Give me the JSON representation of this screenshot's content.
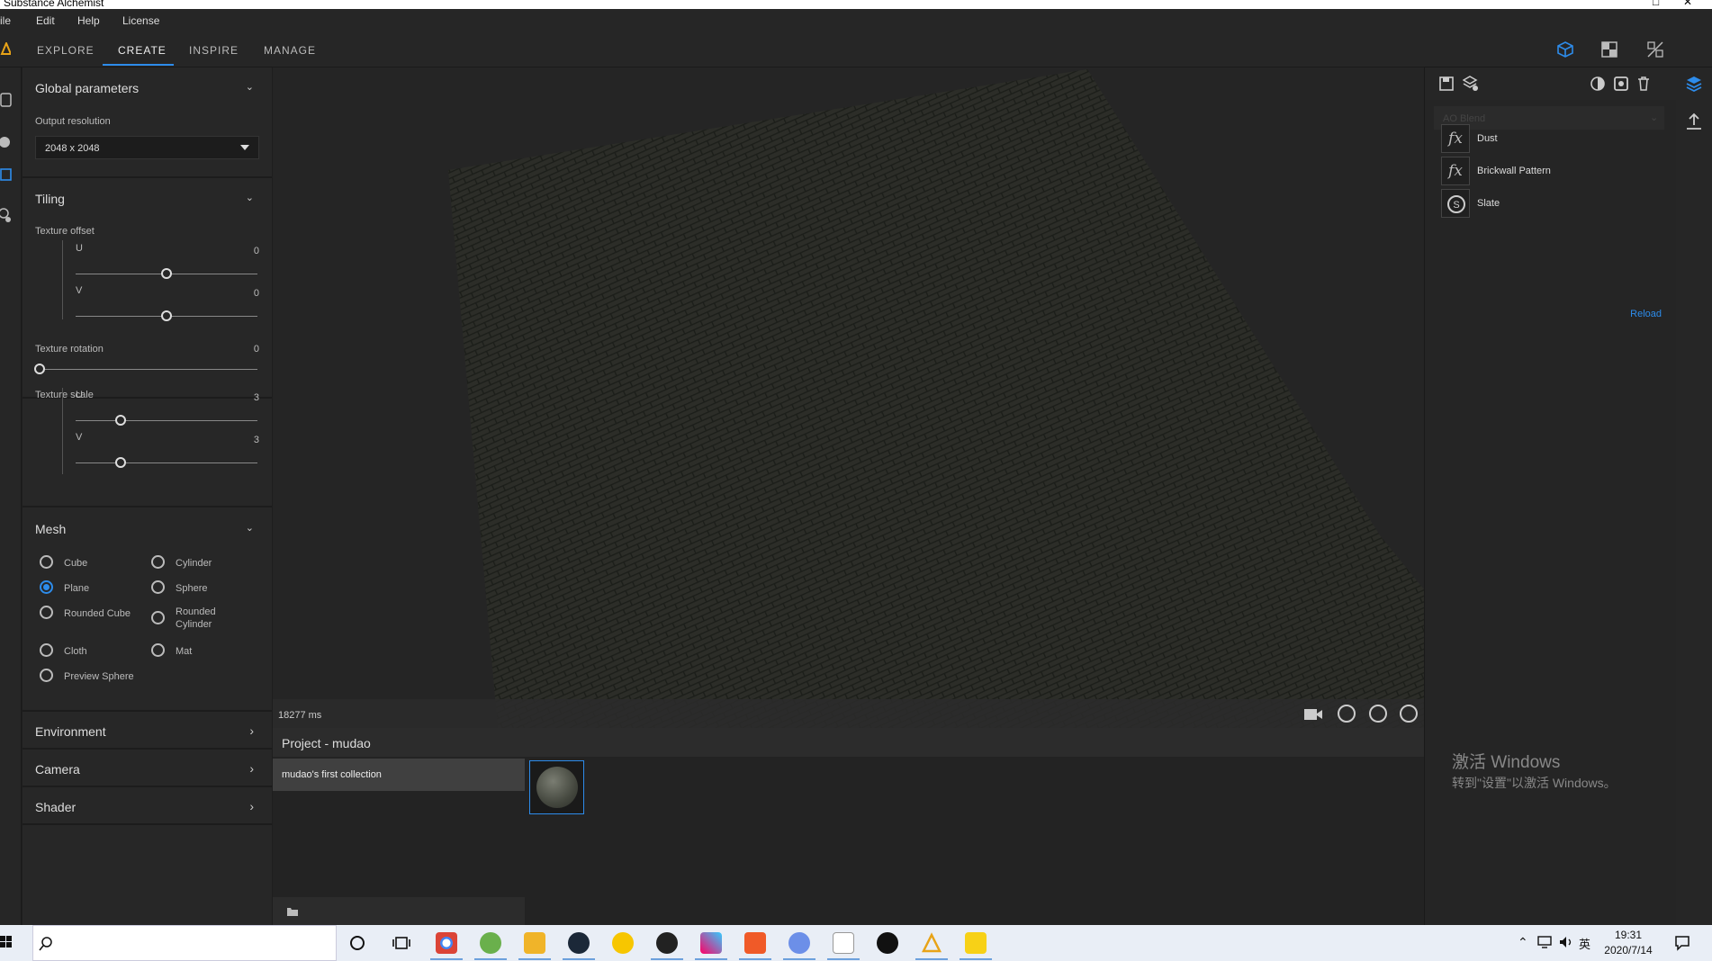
{
  "window": {
    "title": "Substance Alchemist",
    "controls": [
      "□",
      "✕"
    ]
  },
  "menu": {
    "file": "ile",
    "edit": "Edit",
    "help": "Help",
    "license": "License"
  },
  "tabs": [
    "EXPLORE",
    "CREATE",
    "INSPIRE",
    "MANAGE"
  ],
  "global": {
    "title": "Global parameters",
    "res_label": "Output resolution",
    "res_value": "2048 x 2048"
  },
  "tiling": {
    "title": "Tiling",
    "offset_label": "Texture offset",
    "u_label": "U",
    "u_value": "0",
    "v_label": "V",
    "v_value": "0",
    "rotation_label": "Texture rotation",
    "rotation_value": "0",
    "scale_label": "Texture scale",
    "su_label": "U",
    "su_value": "3",
    "sv_label": "V",
    "sv_value": "3",
    "offset_u": 0,
    "offset_v": 0,
    "rotation": 0,
    "scale_u": 3,
    "scale_v": 3
  },
  "mesh": {
    "title": "Mesh",
    "options": [
      "Cube",
      "Cylinder",
      "Plane",
      "Sphere",
      "Rounded Cube",
      "Rounded Cylinder",
      "Cloth",
      "Mat",
      "Preview Sphere"
    ],
    "selected": "Plane"
  },
  "sections": {
    "environment": "Environment",
    "camera": "Camera",
    "shader": "Shader"
  },
  "viewport": {
    "render_time": "18277 ms"
  },
  "project": {
    "title": "Project - mudao",
    "collection": "mudao's first collection"
  },
  "layers": {
    "blend": "AO Blend",
    "items": [
      {
        "icon": "fx",
        "name": "Dust"
      },
      {
        "icon": "fx",
        "name": "Brickwall Pattern"
      },
      {
        "icon": "S",
        "name": "Slate"
      }
    ],
    "reload": "Reload"
  },
  "watermark": {
    "line1": "激活 Windows",
    "line2": "转到\"设置\"以激活 Windows。"
  },
  "taskbar": {
    "time": "19:31",
    "date": "2020/7/14",
    "ime": "英"
  },
  "colors": {
    "accent": "#2d8ceb",
    "panel": "#272727",
    "taskbar": "#e9eef6"
  }
}
